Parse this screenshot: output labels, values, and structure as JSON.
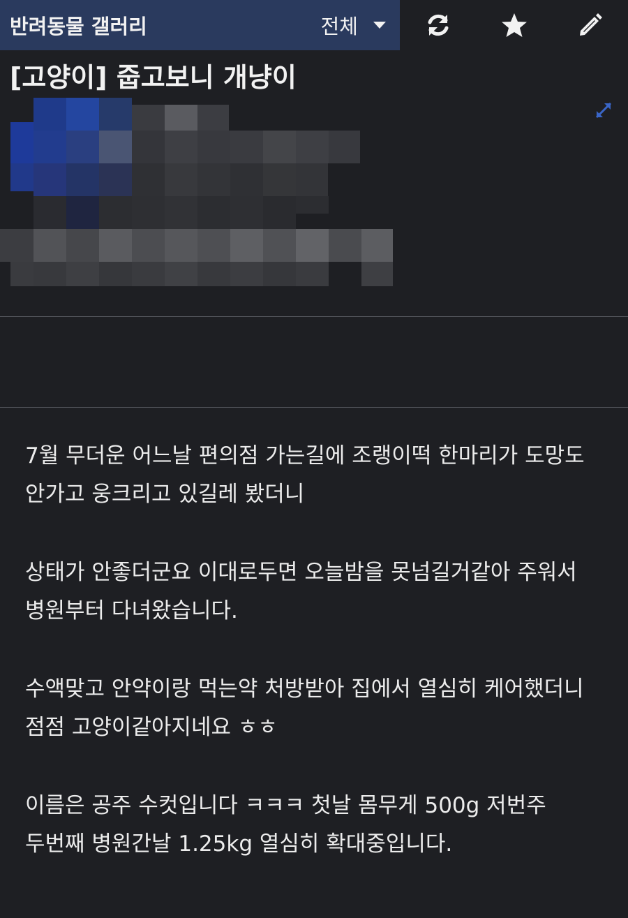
{
  "header": {
    "gallery_name": "반려동물 갤러리",
    "filter_label": "전체",
    "icons": {
      "dropdown": "caret-down-icon",
      "refresh": "refresh-icon",
      "favorite": "star-icon",
      "write": "pencil-icon",
      "expand": "expand-icon"
    },
    "colors": {
      "header_bg": "#2a3a5e",
      "page_bg": "#1e1f23",
      "accent_icon": "#3a66c8"
    }
  },
  "post": {
    "title": "[고양이] 줍고보니 개냥이",
    "paragraphs": [
      "7월 무더운 어느날 편의점 가는길에 조랭이떡 한마리가 도망도 안가고 웅크리고 있길레 봤더니",
      "상태가 안좋더군요 이대로두면 오늘밤을 못넘길거같아 주워서 병원부터 다녀왔습니다.",
      "수액맞고 안약이랑 먹는약 처방받아 집에서 열심히 케어했더니 점점 고양이같아지네요 ㅎㅎ",
      "이름은 공주 수컷입니다 ㅋㅋㅋ 첫날 몸무게 500g 저번주 두번째 병원간날 1.25kg 열심히 확대중입니다."
    ]
  }
}
